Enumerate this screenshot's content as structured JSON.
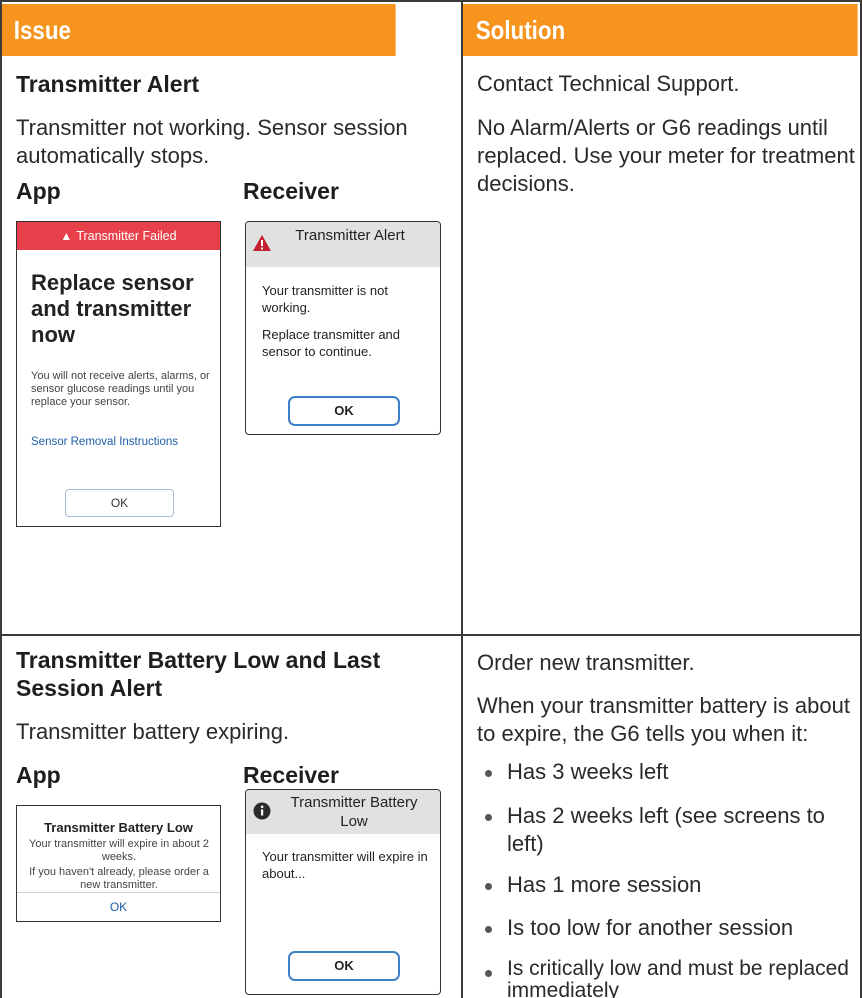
{
  "header": {
    "issue": "Issue",
    "solution": "Solution"
  },
  "row1": {
    "title": "Transmitter Alert",
    "description": "Transmitter not working. Sensor session automatically stops.",
    "app_label": "App",
    "receiver_label": "Receiver",
    "app_screen": {
      "banner": "Transmitter Failed",
      "heading": "Replace sensor and transmitter now",
      "message": "You will not receive alerts, alarms, or sensor glucose readings until you replace your sensor.",
      "link": "Sensor Removal Instructions",
      "ok": "OK"
    },
    "receiver_screen": {
      "title": "Transmitter Alert",
      "message1": "Your transmitter is not working.",
      "message2": "Replace transmitter and sensor to continue.",
      "ok": "OK"
    },
    "solution1": "Contact Technical Support.",
    "solution2": "No Alarm/Alerts or G6 readings until replaced. Use your meter for treatment decisions."
  },
  "row2": {
    "title": "Transmitter Battery Low and Last Session Alert",
    "description": "Transmitter battery expiring.",
    "app_label": "App",
    "receiver_label": "Receiver",
    "app_screen": {
      "title": "Transmitter Battery Low",
      "message1": "Your transmitter will expire in about 2 weeks.",
      "message2": "If you haven't already, please order a new transmitter.",
      "ok": "OK"
    },
    "receiver_screen": {
      "title": "Transmitter Battery Low",
      "message": "Your transmitter will expire in about...",
      "ok": "OK"
    },
    "solution1": "Order new transmitter.",
    "solution2": "When your transmitter battery is about to expire, the G6 tells you when it:",
    "bullets": [
      "Has 3 weeks left",
      "Has 2 weeks left (see screens to left)",
      "Has 1 more session",
      "Is too low for another session",
      "Is critically low and must be replaced immediately"
    ]
  },
  "colors": {
    "header_orange": "#f7941d",
    "banner_red": "#e8404a",
    "link_blue": "#1f5fa8",
    "button_blue": "#3f7fc6",
    "receiver_header_gray": "#dfe2e0"
  }
}
